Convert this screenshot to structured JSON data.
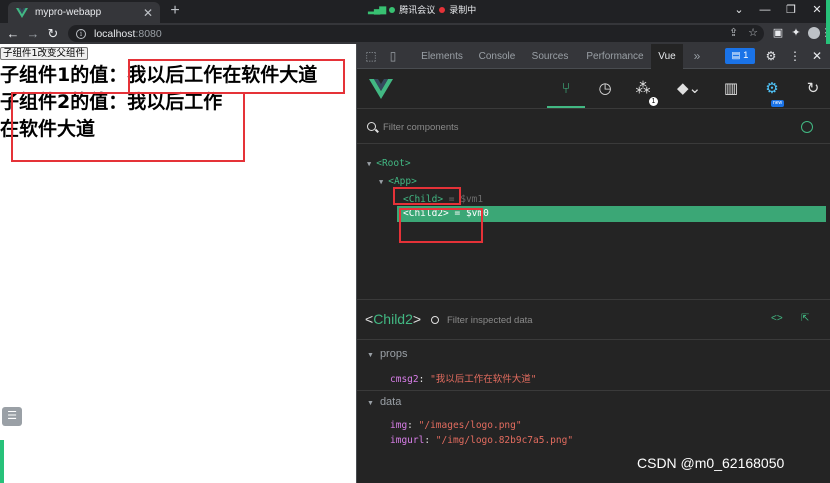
{
  "browser": {
    "tab_title": "mypro-webapp",
    "new_tab_symbol": "+",
    "meeting_app": "腾讯会议",
    "recording_text": "录制中",
    "url_host": "localhost",
    "url_port": ":8080"
  },
  "page": {
    "button_label": "子组件1改变父组件",
    "line1": "子组件1的值：我以后工作在软件大道",
    "line2": "子组件2的值：我以后工作",
    "line3": "在软件大道"
  },
  "devtools": {
    "tabs": [
      "Elements",
      "Console",
      "Sources",
      "Performance",
      "Vue"
    ],
    "more_tabs": "»",
    "issues_count": "1",
    "timeline_badge": "1",
    "new_label": "new",
    "component_filter_placeholder": "Filter components",
    "tree": {
      "root": "<Root>",
      "app": "<App>",
      "child": "<Child>",
      "child_meta": "= $vm1",
      "child2": "<Child2>",
      "child2_meta": "= $vm0"
    },
    "inspector": {
      "component_name": "Child2",
      "filter_placeholder": "Filter inspected data",
      "sections": {
        "props_title": "props",
        "data_title": "data"
      },
      "props": [
        {
          "key": "cmsg2",
          "value": "\"我以后工作在软件大道\""
        }
      ],
      "data": [
        {
          "key": "img",
          "value": "\"/images/logo.png\""
        },
        {
          "key": "imgurl",
          "value": "\"/img/logo.82b9c7a5.png\""
        }
      ]
    }
  },
  "watermark": "CSDN @m0_62168050",
  "colors": {
    "vue_green": "#42b883",
    "selection": "#3ba776",
    "annotation_red": "#e53238",
    "string_red": "#e36c5f",
    "key_purple": "#d87ee8"
  }
}
